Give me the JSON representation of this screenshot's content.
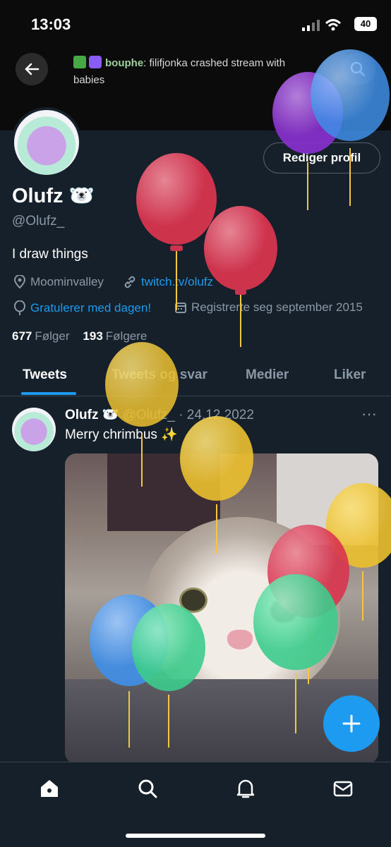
{
  "status_bar": {
    "time": "13:03",
    "battery": "40"
  },
  "banner": {
    "chat_user": "bouphe",
    "chat_message": " filifjonka crashed stream with babies"
  },
  "profile": {
    "edit_label": "Rediger profil",
    "name": "Olufz 🐻‍❄️",
    "handle": "@Olufz_",
    "bio": "I draw things",
    "location": "Moominvalley",
    "website": "twitch.tv/olufz",
    "birthday": "Gratulerer med dagen!",
    "joined": "Registrerte seg september 2015",
    "following_count": "677",
    "following_label": "Følger",
    "followers_count": "193",
    "followers_label": "Følgere"
  },
  "tabs": [
    {
      "label": "Tweets"
    },
    {
      "label": "Tweets og svar"
    },
    {
      "label": "Medier"
    },
    {
      "label": "Liker"
    }
  ],
  "tweet": {
    "name": "Olufz 🐻‍❄️",
    "handle_date": "@Olufz_ · 24.12.2022",
    "more": "···",
    "text": "Merry chrimbus ✨"
  },
  "colors": {
    "accent": "#1d9bf0",
    "background": "#15202b"
  },
  "icons": [
    "back-arrow-icon",
    "search-icon",
    "location-icon",
    "link-icon",
    "balloon-icon",
    "calendar-icon",
    "home-icon",
    "explore-icon",
    "bell-icon",
    "mail-icon",
    "plus-icon"
  ]
}
